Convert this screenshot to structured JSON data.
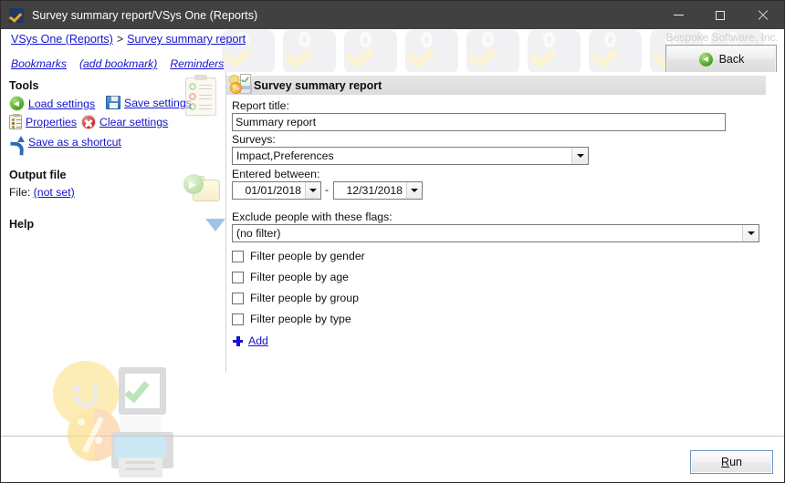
{
  "window": {
    "title": "Survey summary report/VSys One (Reports)",
    "app_icon": "vsys-shield-icon",
    "minimize_label": "—",
    "maximize_label": "□",
    "close_label": "✕"
  },
  "header": {
    "breadcrumb": {
      "root": "VSys One (Reports)",
      "separator": ">",
      "current": "Survey summary report"
    },
    "bookmarks": [
      {
        "label": "Bookmarks"
      },
      {
        "label": "(add bookmark)"
      },
      {
        "label": "Reminders"
      }
    ],
    "company_watermark": "Bespoke Software, Inc.",
    "back_button": {
      "label": "Back",
      "icon": "green-back-arrow-icon"
    }
  },
  "sidebar": {
    "tools_heading": "Tools",
    "tools": [
      {
        "label": "Load settings",
        "icon": "green-back-arrow-icon"
      },
      {
        "label": "Save settings",
        "icon": "floppy-disk-icon"
      },
      {
        "label": "Properties",
        "icon": "clipboard-icon"
      },
      {
        "label": "Clear settings",
        "icon": "red-x-circle-icon"
      },
      {
        "label": "Save as a shortcut",
        "icon": "shortcut-arrow-icon"
      }
    ],
    "output_heading": "Output file",
    "output_file_prefix": "File:",
    "output_file_value": "(not set)",
    "help_heading": "Help",
    "help_toggle_icon": "blue-triangle-down-icon"
  },
  "form": {
    "panel_title": "Survey summary report",
    "panel_icon": "survey-report-icon",
    "report_title": {
      "label": "Report title:",
      "value": "Summary report"
    },
    "surveys": {
      "label": "Surveys:",
      "value": "Impact,Preferences"
    },
    "entered_between": {
      "label": "Entered between:",
      "from": "01/01/2018",
      "separator": "-",
      "to": "12/31/2018"
    },
    "exclude_flags": {
      "label": "Exclude people with these flags:",
      "value": "(no filter)"
    },
    "checkboxes": [
      {
        "label": "Filter people by gender",
        "checked": false
      },
      {
        "label": "Filter people by age",
        "checked": false
      },
      {
        "label": "Filter people by group",
        "checked": false
      },
      {
        "label": "Filter people by type",
        "checked": false
      }
    ],
    "add_link": {
      "label": "Add",
      "icon": "plus-icon"
    }
  },
  "footer": {
    "run_button_prefix": "R",
    "run_button_rest": "un",
    "run_button_label": "Run"
  },
  "decor": {
    "background_illustration": "survey-report-composite-illustration",
    "header_pattern": "vsys-logo-tile-pattern",
    "percent_glyph": "%"
  },
  "colors": {
    "titlebar": "#414141",
    "link": "#1414cc",
    "panel_header": "#e6e6e6",
    "accent_green": "#3f9b20",
    "accent_blue": "#2b6cb8",
    "focus_border": "#6b93c8"
  }
}
